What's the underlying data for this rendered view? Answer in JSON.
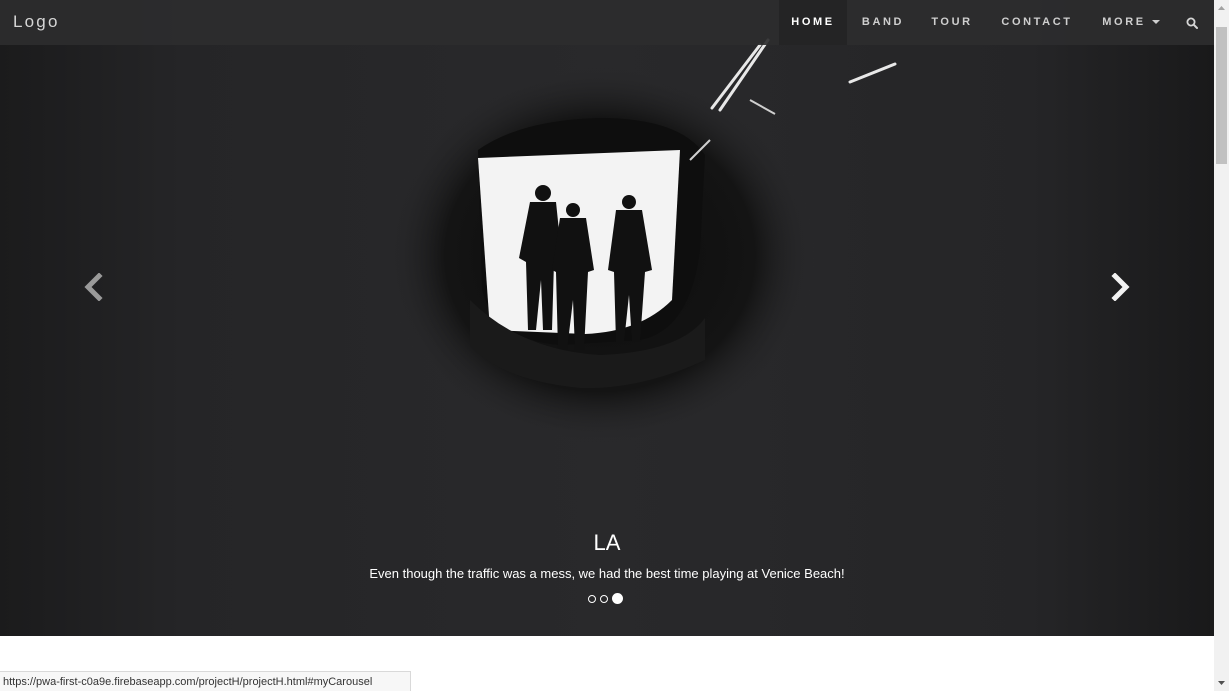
{
  "navbar": {
    "logo": "Logo",
    "items": [
      {
        "label": "HOME",
        "active": true
      },
      {
        "label": "BAND"
      },
      {
        "label": "TOUR"
      },
      {
        "label": "CONTACT"
      },
      {
        "label": "MORE"
      }
    ],
    "search_icon": "search-icon"
  },
  "carousel": {
    "caption_title": "LA",
    "caption_text": "Even though the traffic was a mess, we had the best time playing at Venice Beach!",
    "indicator_count": 3,
    "active_indicator": 3,
    "prev_icon": "chevron-left-icon",
    "next_icon": "chevron-right-icon"
  },
  "status_bar": {
    "url": "https://pwa-first-c0a9e.firebaseapp.com/projectH/projectH.html#myCarousel"
  },
  "colors": {
    "navbar_bg": "#2c2c2e",
    "carousel_bg": "#29292b",
    "text": "#ffffff"
  }
}
